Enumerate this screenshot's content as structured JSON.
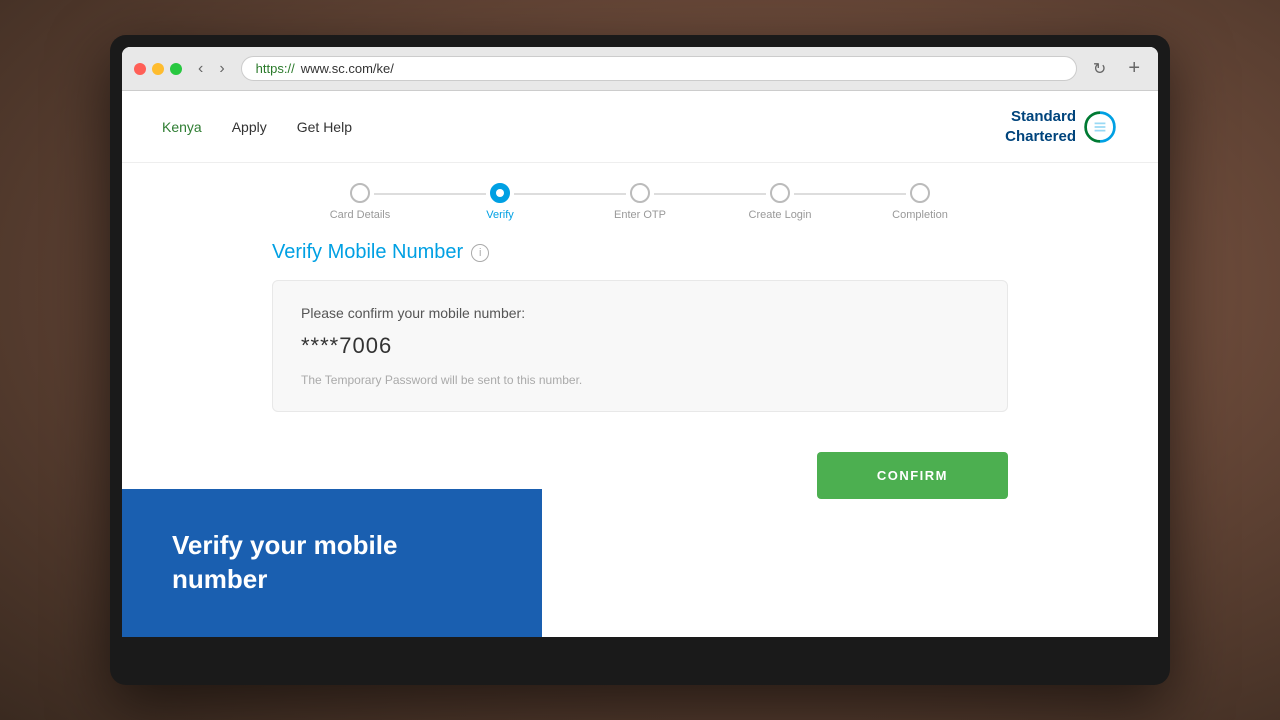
{
  "desktop": {
    "bg_color": "#7a5c4a"
  },
  "browser": {
    "url": "https://www.sc.com/ke/",
    "url_protocol": "https://",
    "url_domain": "www.sc.com/ke/"
  },
  "navbar": {
    "region": "Kenya",
    "apply": "Apply",
    "help": "Get Help",
    "logo_text_line1": "Standard",
    "logo_text_line2": "Chartered"
  },
  "steps": [
    {
      "label": "Card Details",
      "state": "inactive"
    },
    {
      "label": "Verify",
      "state": "active"
    },
    {
      "label": "Enter OTP",
      "state": "inactive"
    },
    {
      "label": "Create Login",
      "state": "inactive"
    },
    {
      "label": "Completion",
      "state": "inactive"
    }
  ],
  "main": {
    "section_title": "Verify Mobile Number",
    "confirm_label": "Please confirm your mobile number:",
    "phone_number": "****7006",
    "temp_password_note": "The Temporary Password will be sent to this number.",
    "confirm_button": "CONFIRM"
  },
  "banner": {
    "text": "Verify your mobile number",
    "bg_color": "#1a5fb0"
  }
}
